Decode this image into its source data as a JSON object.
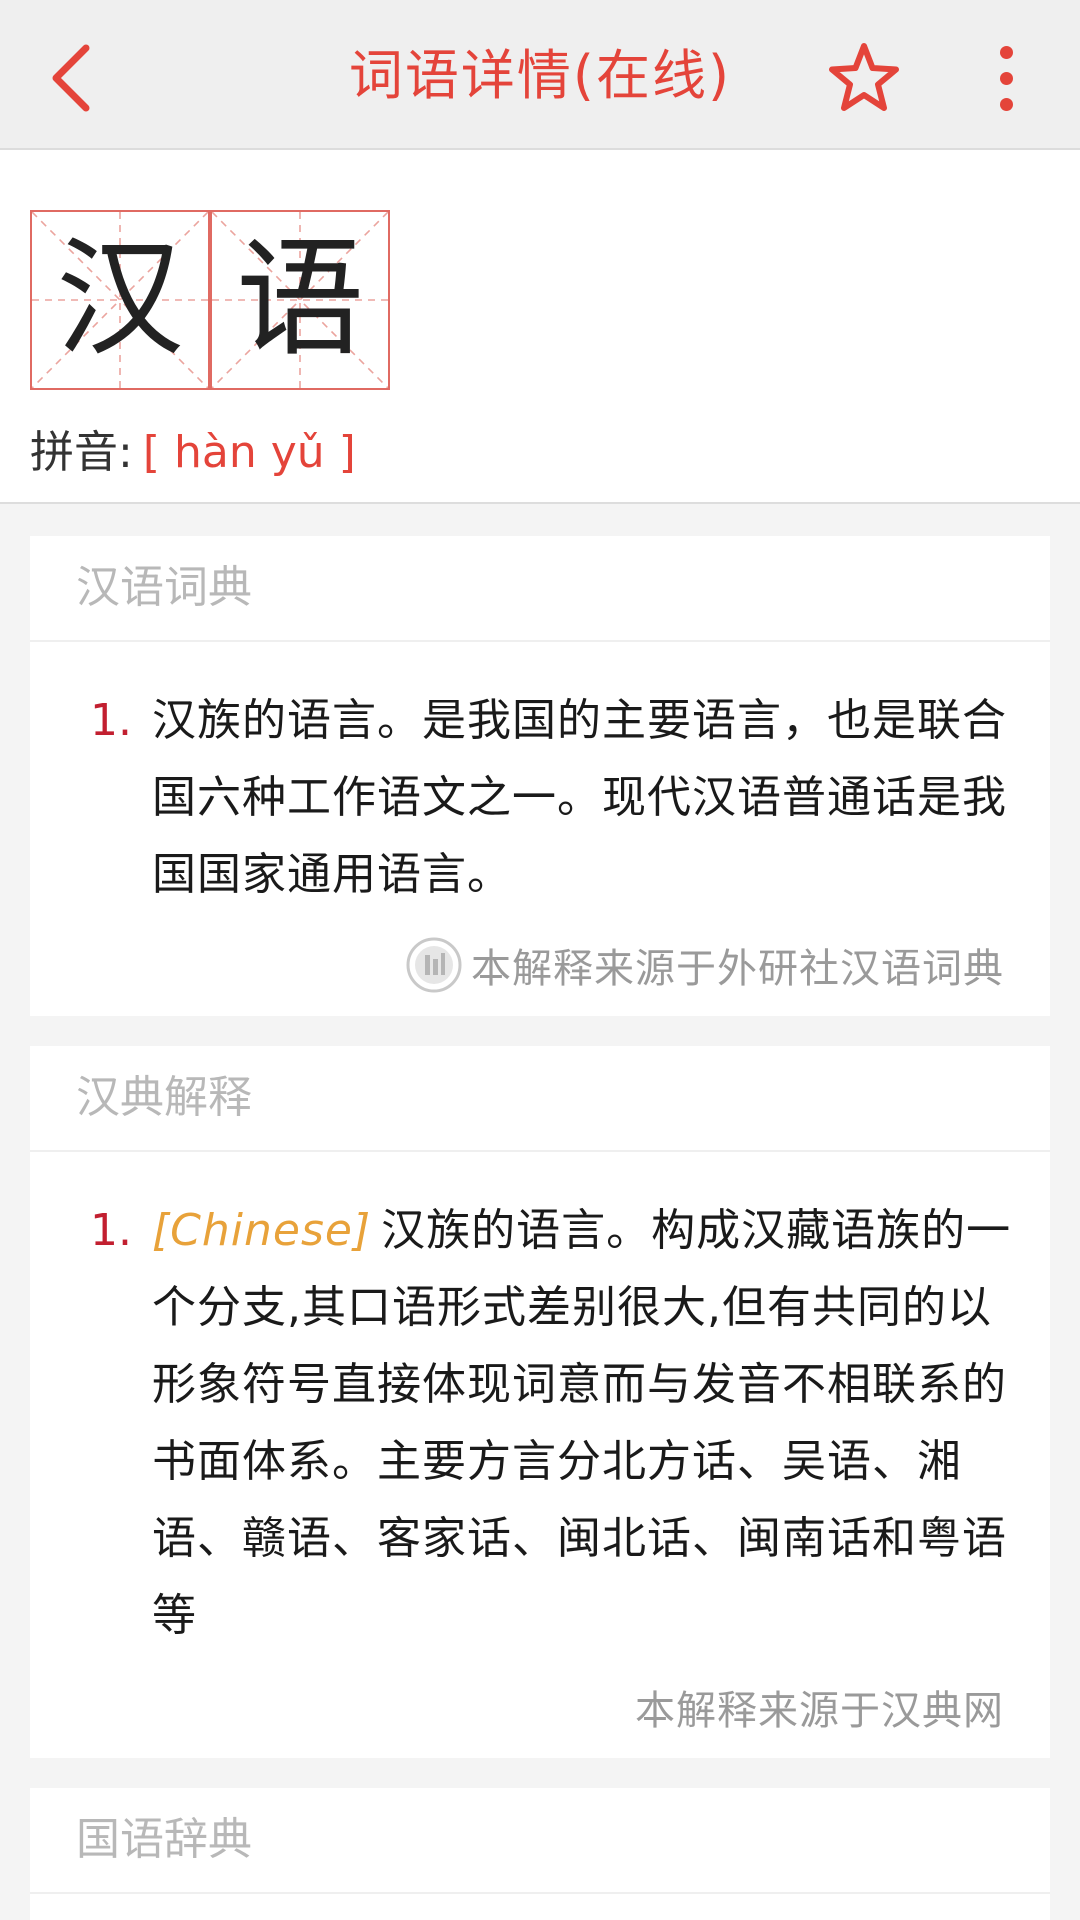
{
  "header": {
    "title": "词语详情(在线)",
    "accent_color": "#e4443a",
    "icons": {
      "back": "chevron-left-icon",
      "favorite": "star-outline-icon",
      "more": "more-vertical-icon"
    }
  },
  "word": {
    "characters": [
      "汉",
      "语"
    ],
    "pinyin_label": "拼音:",
    "pinyin": "[ hàn yǔ ]"
  },
  "sections": [
    {
      "title": "汉语词典",
      "definitions": [
        {
          "number": "1.",
          "tag": "",
          "text": "汉族的语言。是我国的主要语言，也是联合国六种工作语文之一。现代汉语普通话是我国国家通用语言。"
        }
      ],
      "source": "本解释来源于外研社汉语词典",
      "source_icon": "publisher-logo-icon"
    },
    {
      "title": "汉典解释",
      "definitions": [
        {
          "number": "1.",
          "tag": "[Chinese]",
          "text": "汉族的语言。构成汉藏语族的一个分支,其口语形式差别很大,但有共同的以形象符号直接体现词意而与发音不相联系的书面体系。主要方言分北方话、吴语、湘语、赣语、客家话、闽北话、闽南话和粤语等"
        }
      ],
      "source": "本解释来源于汉典网"
    },
    {
      "title": "国语辞典"
    }
  ]
}
